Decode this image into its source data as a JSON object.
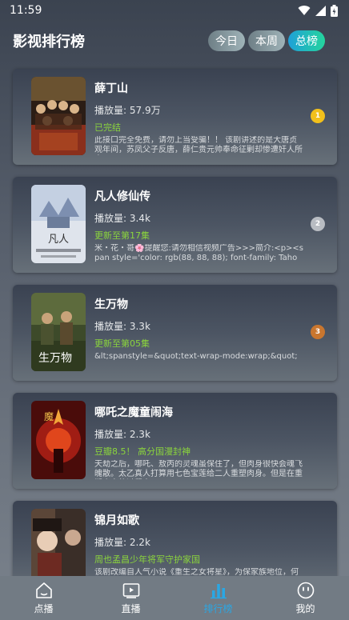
{
  "status_bar": {
    "time": "11:59"
  },
  "header": {
    "title": "影视排行榜",
    "tabs": [
      {
        "label": "今日",
        "active": false
      },
      {
        "label": "本周",
        "active": false
      },
      {
        "label": "总榜",
        "active": true
      }
    ]
  },
  "items": [
    {
      "title": "薛丁山",
      "plays": "播放量: 57.9万",
      "status": "已完结",
      "desc": "此接口完全免费，请勿上当受骗！！ 该剧讲述的是大唐贞观年间，苏凤父子反唐，薛仁贵元帅奉命征剿却惨遭奸人所害…",
      "rank": "1",
      "rank_color": "#f2c01b"
    },
    {
      "title": "凡人修仙传",
      "plays": "播放量: 3.4k",
      "status": "更新至第17集",
      "desc": "米・花・哥🌸提醒您:请勿相信视频广告>>>简介:<p><span style='color: rgb(88, 88, 88); font-family: Tahoma, &quot;hir...",
      "rank": "2",
      "rank_color": "#b8bcc2"
    },
    {
      "title": "生万物",
      "plays": "播放量: 3.3k",
      "status": "更新至第05集",
      "desc": "&lt;spanstyle=&quot;text-wrap-mode:wrap;&quot;",
      "rank": "3",
      "rank_color": "#c9762f"
    },
    {
      "title": "哪吒之魔童闹海",
      "plays": "播放量: 2.3k",
      "status": "豆瓣8.5！ 高分国漫封神",
      "desc": "天劫之后，哪吒、敖丙的灵魂虽保住了，但肉身很快会魂飞魄散。太乙真人打算用七色宝莲给二人重塑肉身。但是在重塑肉身的过程中…",
      "rank": "",
      "rank_color": ""
    },
    {
      "title": "锦月如歌",
      "plays": "播放量: 2.2k",
      "status": "周也孟昌少年将军守护家国",
      "desc": "该剧改编自人气小说《重生之女将星》，为保家族地位，何家长女何",
      "rank": "",
      "rank_color": ""
    }
  ],
  "bottom_nav": [
    {
      "label": "点播",
      "icon": "home-icon",
      "active": false
    },
    {
      "label": "直播",
      "icon": "live-tv-icon",
      "active": false
    },
    {
      "label": "排行榜",
      "icon": "bar-chart-icon",
      "active": true
    },
    {
      "label": "我的",
      "icon": "smiley-icon",
      "active": false
    }
  ]
}
